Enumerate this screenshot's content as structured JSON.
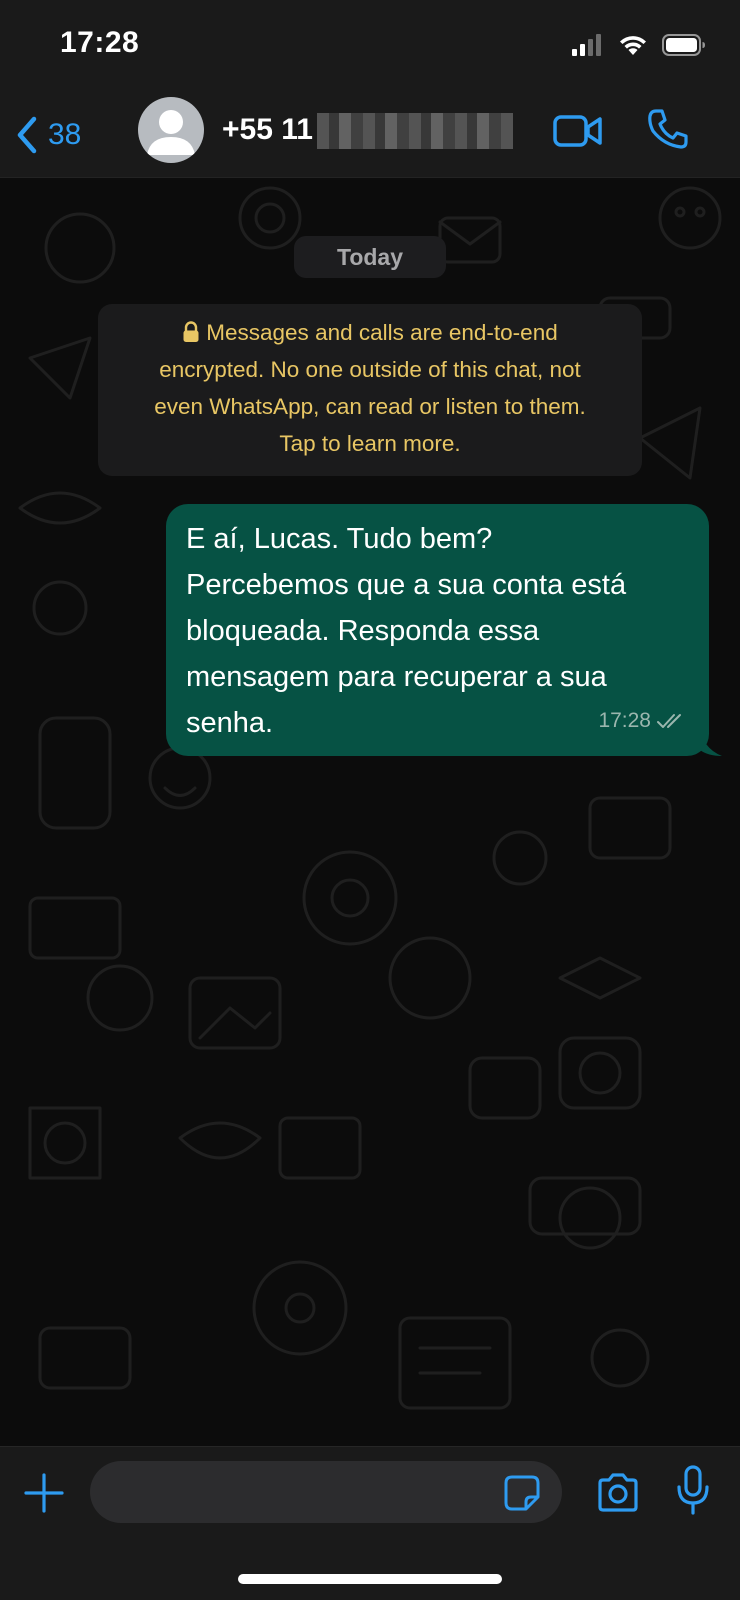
{
  "status_bar": {
    "time": "17:28",
    "icons": [
      "cellular-signal-icon",
      "wifi-icon",
      "battery-icon"
    ]
  },
  "header": {
    "back_count": "38",
    "back_icon": "chevron-left-icon",
    "avatar_icon": "default-avatar-icon",
    "contact_name": "+55 11",
    "contact_number_redacted": true,
    "video_call_icon": "video-camera-icon",
    "voice_call_icon": "phone-icon"
  },
  "chat": {
    "date_label": "Today",
    "encryption_notice": {
      "lines": [
        "Messages and calls are end-to-end",
        "encrypted. No one outside of this chat, not",
        "even WhatsApp, can read or listen to them.",
        "Tap to learn more."
      ],
      "icon": "lock-icon"
    },
    "messages": [
      {
        "direction": "outgoing",
        "lines": [
          "E aí, Lucas. Tudo bem?",
          "Percebemos que a sua conta está",
          "bloqueada. Responda essa",
          "mensagem para recuperar a sua",
          "senha."
        ],
        "time": "17:28",
        "status": "delivered",
        "status_icon": "double-check-icon"
      }
    ]
  },
  "input_bar": {
    "placeholder": "",
    "icons": [
      "plus-icon",
      "sticker-icon",
      "camera-icon",
      "microphone-icon"
    ]
  },
  "colors": {
    "accent": "#2e9bf0",
    "outgoing_bubble": "#065244",
    "notice_text": "#e8c664",
    "bar_background": "#1a1a1a"
  }
}
